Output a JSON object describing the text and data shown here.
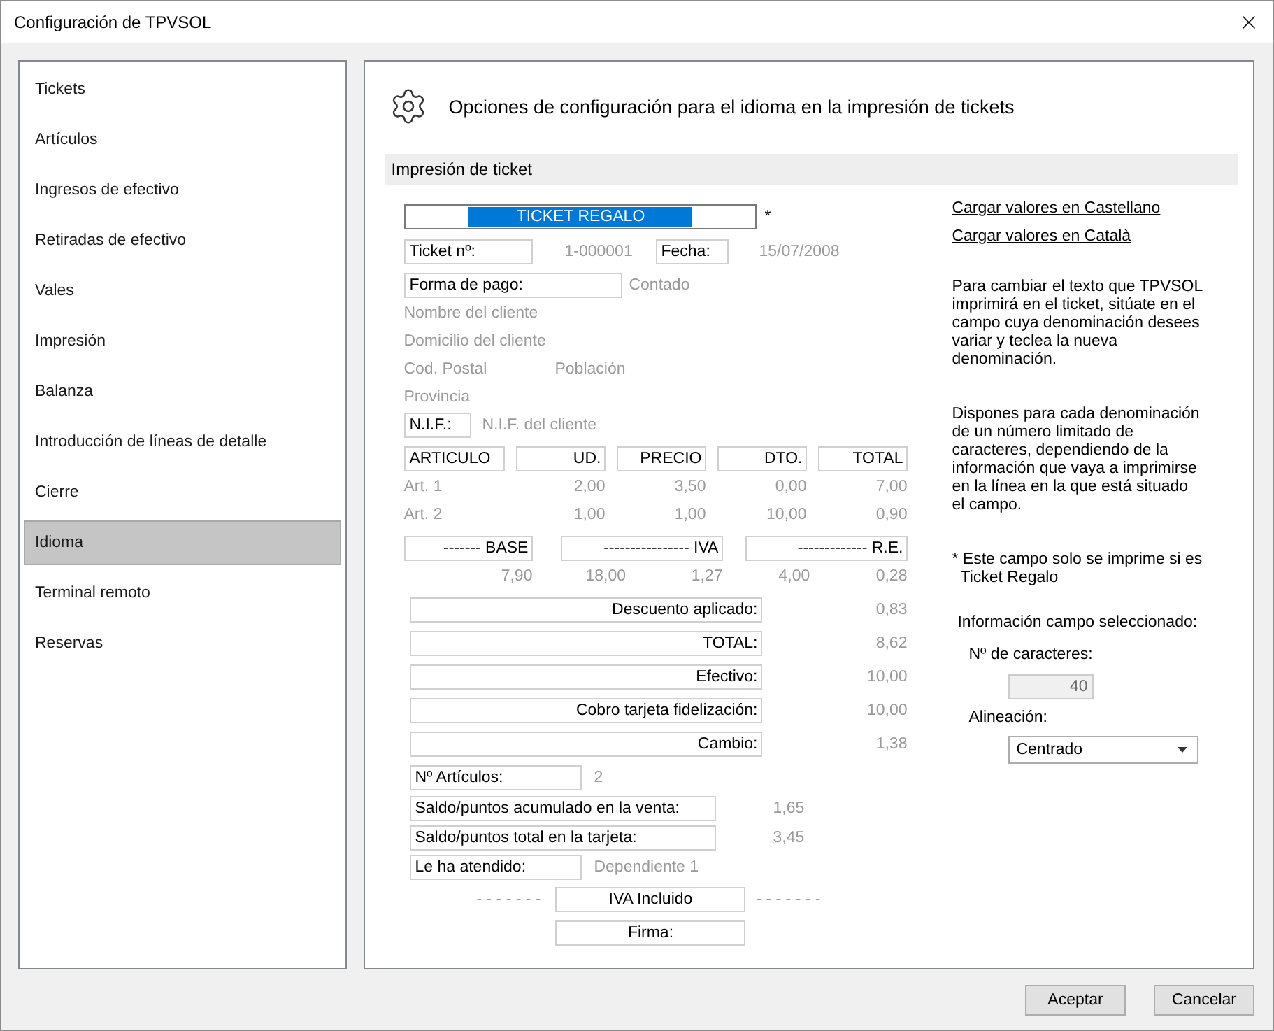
{
  "window": {
    "title": "Configuración de TPVSOL"
  },
  "sidebar": {
    "items": [
      {
        "label": "Tickets",
        "selected": false
      },
      {
        "label": "Artículos",
        "selected": false
      },
      {
        "label": "Ingresos de efectivo",
        "selected": false
      },
      {
        "label": "Retiradas de efectivo",
        "selected": false
      },
      {
        "label": "Vales",
        "selected": false
      },
      {
        "label": "Impresión",
        "selected": false
      },
      {
        "label": "Balanza",
        "selected": false
      },
      {
        "label": "Introducción de líneas de detalle",
        "selected": false
      },
      {
        "label": "Cierre",
        "selected": false
      },
      {
        "label": "Idioma",
        "selected": true
      },
      {
        "label": "Terminal remoto",
        "selected": false
      },
      {
        "label": "Reservas",
        "selected": false
      }
    ]
  },
  "panel": {
    "heading": "Opciones de configuración para el idioma en la impresión de tickets",
    "section_title": "Impresión de ticket"
  },
  "ticket": {
    "gift_line": {
      "value": "TICKET REGALO",
      "selected": true,
      "marker": "*"
    },
    "number": {
      "label": "Ticket nº:",
      "value": "1-000001"
    },
    "date": {
      "label": "Fecha:",
      "value": "15/07/2008"
    },
    "payment": {
      "label": "Forma de pago:",
      "value": "Contado"
    },
    "customer": {
      "name": "Nombre del cliente",
      "address": "Domicilio del cliente",
      "postal_code": "Cod. Postal",
      "city": "Población",
      "province": "Provincia"
    },
    "nif": {
      "label": "N.I.F.:",
      "value": "N.I.F. del cliente"
    },
    "lines": {
      "columns": [
        "ARTICULO",
        "UD.",
        "PRECIO",
        "DTO.",
        "TOTAL"
      ],
      "rows": [
        [
          "Art. 1",
          "2,00",
          "3,50",
          "0,00",
          "7,00"
        ],
        [
          "Art. 2",
          "1,00",
          "1,00",
          "10,00",
          "0,90"
        ]
      ]
    },
    "taxes": {
      "columns": [
        "------- BASE",
        "---------------- IVA",
        "------------- R.E."
      ],
      "base": "7,90",
      "iva_rate": "18,00",
      "iva_amount": "1,27",
      "re_rate": "4,00",
      "re_amount": "0,28"
    },
    "totals": [
      {
        "label": "Descuento aplicado:",
        "value": "0,83"
      },
      {
        "label": "TOTAL:",
        "value": "8,62"
      },
      {
        "label": "Efectivo:",
        "value": "10,00"
      },
      {
        "label": "Cobro tarjeta fidelización:",
        "value": "10,00"
      },
      {
        "label": "Cambio:",
        "value": "1,38"
      }
    ],
    "items_count": {
      "label": "Nº Artículos:",
      "value": "2"
    },
    "sale_balance": {
      "label": "Saldo/puntos acumulado en la venta:",
      "value": "1,65"
    },
    "card_balance": {
      "label": "Saldo/puntos total en la tarjeta:",
      "value": "3,45"
    },
    "served_by": {
      "label": "Le ha atendido:",
      "value": "Dependiente 1"
    },
    "vat_line": {
      "dashes_left": "- - - - - - -",
      "label": "IVA Incluido",
      "dashes_right": "- - - - - - -"
    },
    "signature": {
      "label": "Firma:"
    }
  },
  "help": {
    "links": [
      "Cargar valores en Castellano",
      "Cargar valores en Català"
    ],
    "paragraphs": [
      "Para cambiar el texto que TPVSOL imprimirá en el ticket, sitúate en el campo cuya denominación desees variar y teclea la nueva denominación.",
      "Dispones para cada denominación de un número limitado de caracteres, dependiendo de la información que vaya a imprimirse en la línea en la que está situado el campo."
    ],
    "note": "* Este campo solo se imprime si es Ticket Regalo",
    "field_info": {
      "title": "Información campo seleccionado:",
      "length_label": "Nº de caracteres:",
      "length_value": "40",
      "length_disabled": true,
      "alignment_label": "Alineación:",
      "alignment_value": "Centrado"
    }
  },
  "buttons": [
    "Aceptar",
    "Cancelar"
  ]
}
